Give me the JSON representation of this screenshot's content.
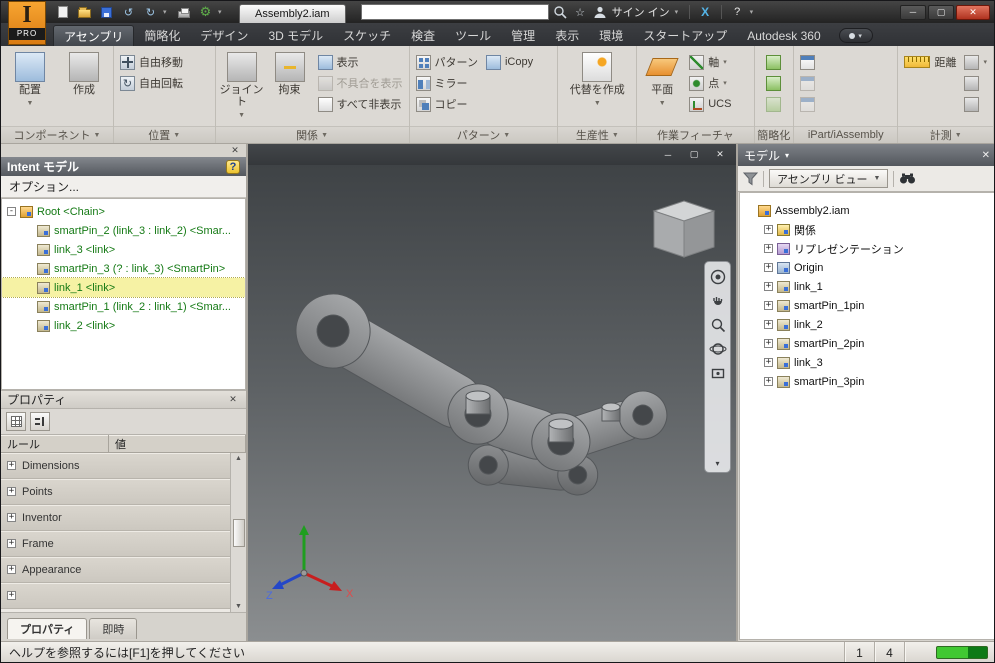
{
  "title_bar": {
    "app_initial": "I",
    "app_sub": "PRO",
    "document": "Assembly2.iam",
    "sign_in": "サイン イン",
    "exchange_x": "X"
  },
  "search": {
    "value": ""
  },
  "icons": {
    "dropdown": "▼",
    "dropdown_small": "▾",
    "close": "✕",
    "minimize": "─",
    "maximize": "▢",
    "help": "?",
    "undo": "↺",
    "redo": "↻",
    "gear": "⚙",
    "star": "☆",
    "scroll_up": "▲",
    "scroll_down": "▼"
  },
  "ribbon_tabs": [
    {
      "label": "アセンブリ",
      "active": true
    },
    {
      "label": "簡略化"
    },
    {
      "label": "デザイン"
    },
    {
      "label": "3D モデル"
    },
    {
      "label": "スケッチ"
    },
    {
      "label": "検査"
    },
    {
      "label": "ツール"
    },
    {
      "label": "管理"
    },
    {
      "label": "表示"
    },
    {
      "label": "環境"
    },
    {
      "label": "スタートアップ"
    },
    {
      "label": "Autodesk 360"
    }
  ],
  "ribbon": {
    "groups": {
      "component": {
        "label": "コンポーネント",
        "place": "配置",
        "create": "作成"
      },
      "position": {
        "label": "位置",
        "free_move": "自由移動",
        "free_rotate": "自由回転"
      },
      "relationships": {
        "label": "関係",
        "joint": "ジョイント",
        "constrain": "拘束",
        "show": "表示",
        "show_sick": "不具合を表示",
        "hide_all": "すべて非表示"
      },
      "pattern": {
        "label": "パターン",
        "pattern": "パターン",
        "icopy": "iCopy",
        "mirror": "ミラー",
        "copy": "コピー"
      },
      "productivity": {
        "label": "生産性",
        "create_substitutes": "代替を作成"
      },
      "work_features": {
        "label": "作業フィーチャ",
        "plane": "平面",
        "axis": "軸",
        "point": "点",
        "ucs": "UCS"
      },
      "simplify": {
        "label": "簡略化"
      },
      "ipart": {
        "label": "iPart/iAssembly"
      },
      "measure": {
        "label": "計測",
        "distance": "距離"
      }
    }
  },
  "intent_panel": {
    "title": "Intent モデル",
    "options": "オプション...",
    "tree": [
      {
        "label": "Root <Chain>",
        "level": 0,
        "icon": "assembly",
        "exp": "-"
      },
      {
        "label": "smartPin_2 (link_3 : link_2) <Smar...",
        "level": 1,
        "icon": "part",
        "exp": ""
      },
      {
        "label": "link_3 <link>",
        "level": 1,
        "icon": "part",
        "exp": ""
      },
      {
        "label": "smartPin_3 (? : link_3) <SmartPin>",
        "level": 1,
        "icon": "part",
        "exp": ""
      },
      {
        "label": "link_1 <link>",
        "level": 1,
        "icon": "part",
        "exp": "",
        "selected": true
      },
      {
        "label": "smartPin_1 (link_2 : link_1) <Smar...",
        "level": 1,
        "icon": "part",
        "exp": ""
      },
      {
        "label": "link_2 <link>",
        "level": 1,
        "icon": "part",
        "exp": ""
      }
    ]
  },
  "properties_panel": {
    "title": "プロパティ",
    "col_rule": "ルール",
    "col_value": "値",
    "rows": [
      {
        "label": "Dimensions",
        "exp": "+"
      },
      {
        "label": "Points",
        "exp": "+"
      },
      {
        "label": "Inventor",
        "exp": "+"
      },
      {
        "label": "Frame",
        "exp": "+"
      },
      {
        "label": "Appearance",
        "exp": "+"
      },
      {
        "label": "",
        "exp": "+"
      }
    ],
    "tabs": [
      "プロパティ",
      "即時"
    ]
  },
  "model_browser": {
    "title": "モデル",
    "view_selector": "アセンブリ ビュー",
    "tree": [
      {
        "label": "Assembly2.iam",
        "level": 0,
        "icon": "assembly",
        "exp": ""
      },
      {
        "label": "関係",
        "level": 1,
        "icon": "relations",
        "exp": "+"
      },
      {
        "label": "リプレゼンテーション",
        "level": 1,
        "icon": "representations",
        "exp": "+"
      },
      {
        "label": "Origin",
        "level": 1,
        "icon": "origin",
        "exp": "+"
      },
      {
        "label": "link_1",
        "level": 1,
        "icon": "part",
        "exp": "+"
      },
      {
        "label": "smartPin_1pin",
        "level": 1,
        "icon": "part",
        "exp": "+"
      },
      {
        "label": "link_2",
        "level": 1,
        "icon": "part",
        "exp": "+"
      },
      {
        "label": "smartPin_2pin",
        "level": 1,
        "icon": "part",
        "exp": "+"
      },
      {
        "label": "link_3",
        "level": 1,
        "icon": "part",
        "exp": "+"
      },
      {
        "label": "smartPin_3pin",
        "level": 1,
        "icon": "part",
        "exp": "+"
      }
    ]
  },
  "viewport": {
    "axis_x": "X",
    "axis_z": "Z"
  },
  "status_bar": {
    "help_text": "ヘルプを参照するには[F1]を押してください",
    "cell_a": "1",
    "cell_b": "4"
  }
}
